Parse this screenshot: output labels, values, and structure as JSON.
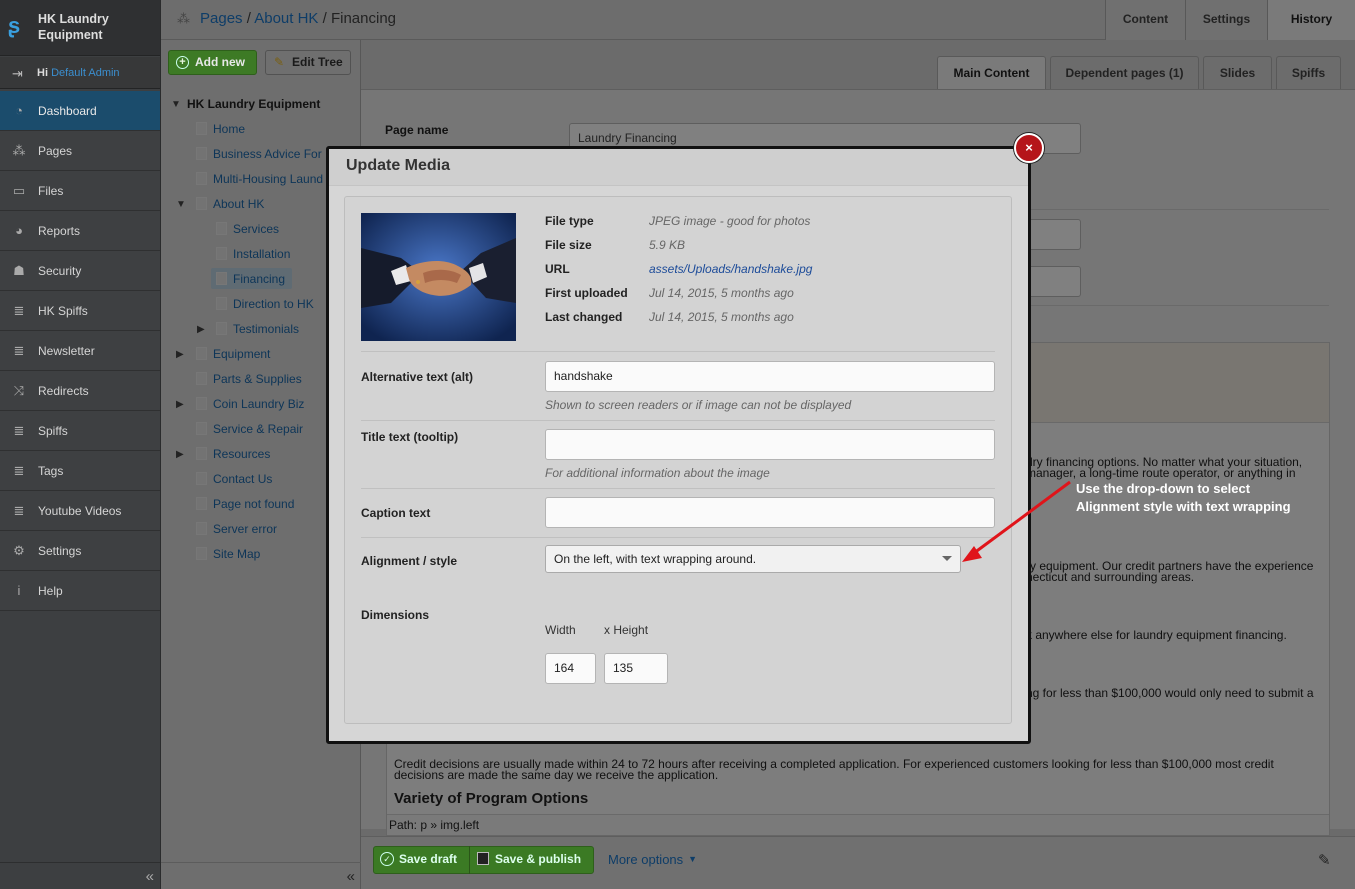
{
  "brand": {
    "title": "HK Laundry Equipment"
  },
  "user": {
    "greeting": "Hi",
    "name": "Default Admin"
  },
  "menu": [
    {
      "label": "Dashboard",
      "icon": "dashboard-icon",
      "active": true
    },
    {
      "label": "Pages",
      "icon": "pages-icon"
    },
    {
      "label": "Files",
      "icon": "files-icon"
    },
    {
      "label": "Reports",
      "icon": "reports-icon"
    },
    {
      "label": "Security",
      "icon": "security-icon"
    },
    {
      "label": "HK Spiffs",
      "icon": "database-icon"
    },
    {
      "label": "Newsletter",
      "icon": "database-icon"
    },
    {
      "label": "Redirects",
      "icon": "shuffle-icon"
    },
    {
      "label": "Spiffs",
      "icon": "database-icon"
    },
    {
      "label": "Tags",
      "icon": "database-icon"
    },
    {
      "label": "Youtube Videos",
      "icon": "database-icon"
    },
    {
      "label": "Settings",
      "icon": "gear-icon"
    },
    {
      "label": "Help",
      "icon": "info-icon"
    }
  ],
  "collapse_glyph": "«",
  "tree_toolbar": {
    "add_label": "Add new",
    "edit_label": "Edit Tree"
  },
  "tree": [
    {
      "label": "HK Laundry Equipment",
      "level": 0,
      "toggle": "open",
      "root": true
    },
    {
      "label": "Home",
      "level": 1
    },
    {
      "label": "Business Advice For",
      "level": 1
    },
    {
      "label": "Multi-Housing Laund",
      "level": 1
    },
    {
      "label": "About HK",
      "level": 1,
      "toggle": "open"
    },
    {
      "label": "Services",
      "level": 2
    },
    {
      "label": "Installation",
      "level": 2
    },
    {
      "label": "Financing",
      "level": 2,
      "current": true
    },
    {
      "label": "Direction to HK",
      "level": 2
    },
    {
      "label": "Testimonials",
      "level": 2,
      "toggle": "closed"
    },
    {
      "label": "Equipment",
      "level": 1,
      "toggle": "closed"
    },
    {
      "label": "Parts & Supplies",
      "level": 1
    },
    {
      "label": "Coin Laundry Biz",
      "level": 1,
      "toggle": "closed"
    },
    {
      "label": "Service & Repair",
      "level": 1
    },
    {
      "label": "Resources",
      "level": 1,
      "toggle": "closed"
    },
    {
      "label": "Contact Us",
      "level": 1
    },
    {
      "label": "Page not found",
      "level": 1
    },
    {
      "label": "Server error",
      "level": 1
    },
    {
      "label": "Site Map",
      "level": 1
    }
  ],
  "breadcrumb": {
    "part1": "Pages",
    "sep": "/",
    "part2": "About HK",
    "current": "Financing"
  },
  "top_tabs": [
    "Content",
    "Settings",
    "History"
  ],
  "sub_tabs": [
    "Main Content",
    "Dependent pages (1)",
    "Slides",
    "Spiffs"
  ],
  "page_form": {
    "page_name_label": "Page name",
    "page_name_value": "Laundry Financing"
  },
  "editor": {
    "lines": [
      "dry financing options. No matter what your situation,",
      "manager, a long-time route operator, or anything in",
      "ry equipment. Our credit partners have the experience",
      "necticut and surrounding areas.",
      "k anywhere else for laundry equipment financing.",
      "ng for less than $100,000 would only need to submit a",
      "Credit decisions are usually made within 24 to 72 hours after receiving a completed application. For experienced customers looking for less than $100,000 most credit",
      "decisions are made the same day we receive the application."
    ],
    "heading": "Variety of Program Options",
    "path": "Path: p » img.left"
  },
  "actions": {
    "save_draft": "Save draft",
    "save_publish": "Save & publish",
    "more_options": "More options"
  },
  "modal": {
    "title": "Update Media",
    "close_glyph": "×",
    "file_info": [
      {
        "label": "File type",
        "value": "JPEG image - good for photos"
      },
      {
        "label": "File size",
        "value": "5.9 KB"
      },
      {
        "label": "URL",
        "value": "assets/Uploads/handshake.jpg"
      },
      {
        "label": "First uploaded",
        "value": "Jul 14, 2015, 5 months ago"
      },
      {
        "label": "Last changed",
        "value": "Jul 14, 2015, 5 months ago"
      }
    ],
    "alt_label": "Alternative text (alt)",
    "alt_value": "handshake",
    "alt_help": "Shown to screen readers or if image can not be displayed",
    "title_label": "Title text (tooltip)",
    "title_value": "",
    "title_help": "For additional information about the image",
    "caption_label": "Caption text",
    "caption_value": "",
    "alignment_label": "Alignment / style",
    "alignment_value": "On the left, with text wrapping around.",
    "dimensions_label": "Dimensions",
    "width_label": "Width",
    "height_label": "x Height",
    "width_value": "164",
    "height_value": "135"
  },
  "annotation": {
    "line1": "Use the drop-down to select",
    "line2": "Alignment style with text wrapping"
  },
  "colors": {
    "accent_green": "#3d7a25",
    "close_red": "#b5151a",
    "annotation_arrow": "#e0141a",
    "link_blue": "#1c4b99"
  }
}
